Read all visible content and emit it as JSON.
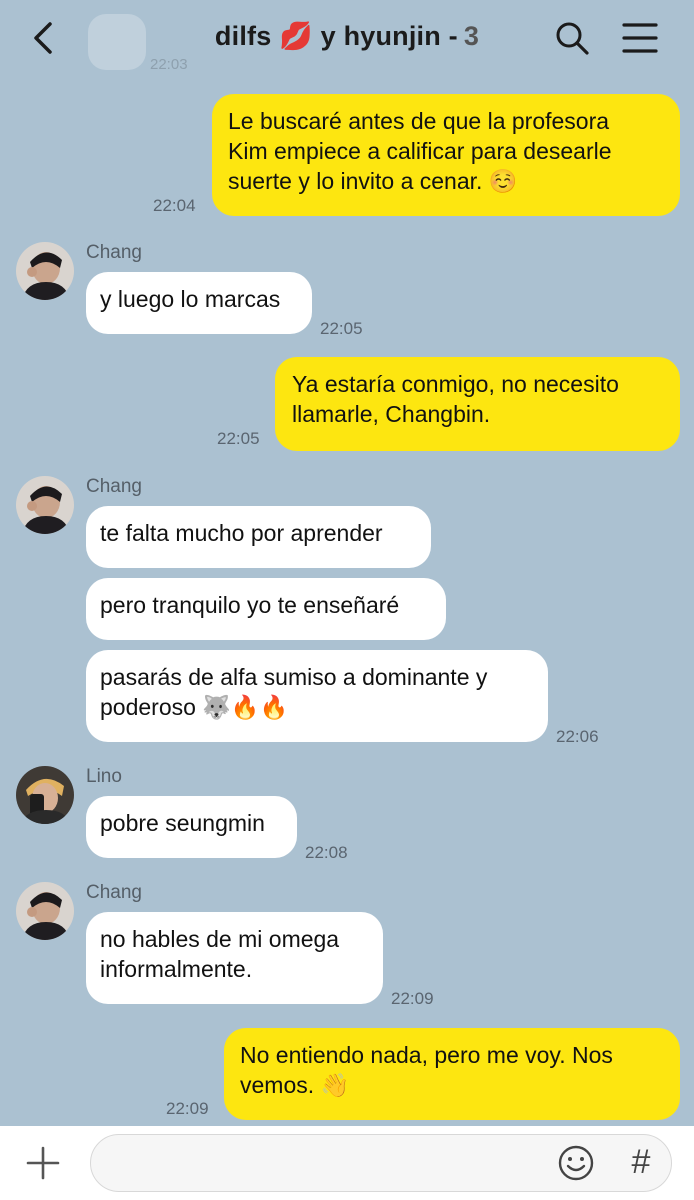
{
  "header": {
    "title": "dilfs 💋 y hyunjin -",
    "member_count": "3",
    "ghost_time": "22:03"
  },
  "messages": [
    {
      "side": "me",
      "text_lines": [
        "Le buscaré antes de que la profesora",
        "Kim empiece a calificar para desearle",
        "suerte y lo invito a cenar. ☺️"
      ],
      "time": "22:04"
    },
    {
      "side": "them",
      "sender": "Chang",
      "text": "y luego lo marcas",
      "time": "22:05"
    },
    {
      "side": "me",
      "text_lines": [
        "Ya estaría conmigo, no necesito",
        "llamarle, Changbin."
      ],
      "time": "22:05"
    },
    {
      "side": "them",
      "sender": "Chang",
      "text": "te falta mucho por aprender"
    },
    {
      "side": "them",
      "text": "pero tranquilo yo te enseñaré"
    },
    {
      "side": "them",
      "text_lines": [
        "pasarás de alfa sumiso a dominante y",
        "poderoso 🐺🔥🔥"
      ],
      "time": "22:06"
    },
    {
      "side": "them",
      "sender": "Lino",
      "text": "pobre seungmin",
      "time": "22:08"
    },
    {
      "side": "them",
      "sender": "Chang",
      "text_lines": [
        "no hables de mi omega",
        "informalmente."
      ],
      "time": "22:09"
    },
    {
      "side": "me",
      "text_lines": [
        "No entiendo nada, pero me voy. Nos",
        "vemos. 👋"
      ],
      "time": "22:09"
    }
  ],
  "input": {
    "placeholder": "",
    "hash_label": "#"
  },
  "colors": {
    "background": "#abc1d1",
    "my_bubble": "#fde610",
    "their_bubble": "#ffffff"
  }
}
